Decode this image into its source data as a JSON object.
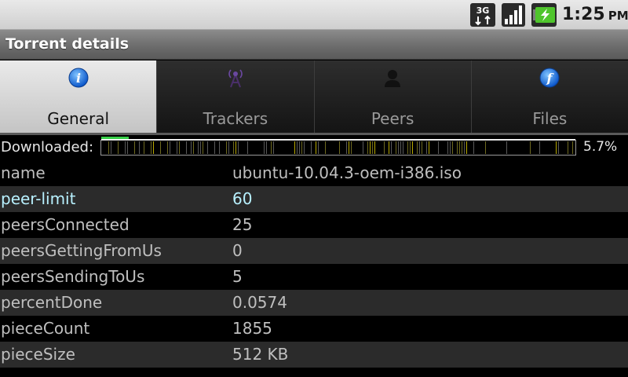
{
  "status_bar": {
    "network_icon": "3g-data-icon",
    "signal_icon": "signal-strength-icon",
    "battery_icon": "battery-charging-icon",
    "time": "1:25",
    "ampm": "PM"
  },
  "title_bar": {
    "title": "Torrent details"
  },
  "tabs": [
    {
      "label": "General",
      "icon": "info-icon",
      "active": true
    },
    {
      "label": "Trackers",
      "icon": "antenna-icon",
      "active": false
    },
    {
      "label": "Peers",
      "icon": "person-icon",
      "active": false
    },
    {
      "label": "Files",
      "icon": "files-icon",
      "active": false
    }
  ],
  "download": {
    "label": "Downloaded:",
    "percent_text": "5.7%",
    "fraction": 0.057,
    "colors": {
      "done": "#39d04a",
      "piece": "#b8a900",
      "empty": "#000000",
      "border": "#9a9a9a"
    }
  },
  "properties": [
    {
      "key": "name",
      "value": "ubuntu-10.04.3-oem-i386.iso",
      "editable": false
    },
    {
      "key": "peer-limit",
      "value": "60",
      "editable": true
    },
    {
      "key": "peersConnected",
      "value": "25",
      "editable": false
    },
    {
      "key": "peersGettingFromUs",
      "value": "0",
      "editable": false
    },
    {
      "key": "peersSendingToUs",
      "value": "5",
      "editable": false
    },
    {
      "key": "percentDone",
      "value": "0.0574",
      "editable": false
    },
    {
      "key": "pieceCount",
      "value": "1855",
      "editable": false
    },
    {
      "key": "pieceSize",
      "value": "512 KB",
      "editable": false
    }
  ],
  "colors": {
    "editable_text": "#b8f1ff",
    "text": "#bfbfbf",
    "row_alt": "#2b2b2b"
  }
}
